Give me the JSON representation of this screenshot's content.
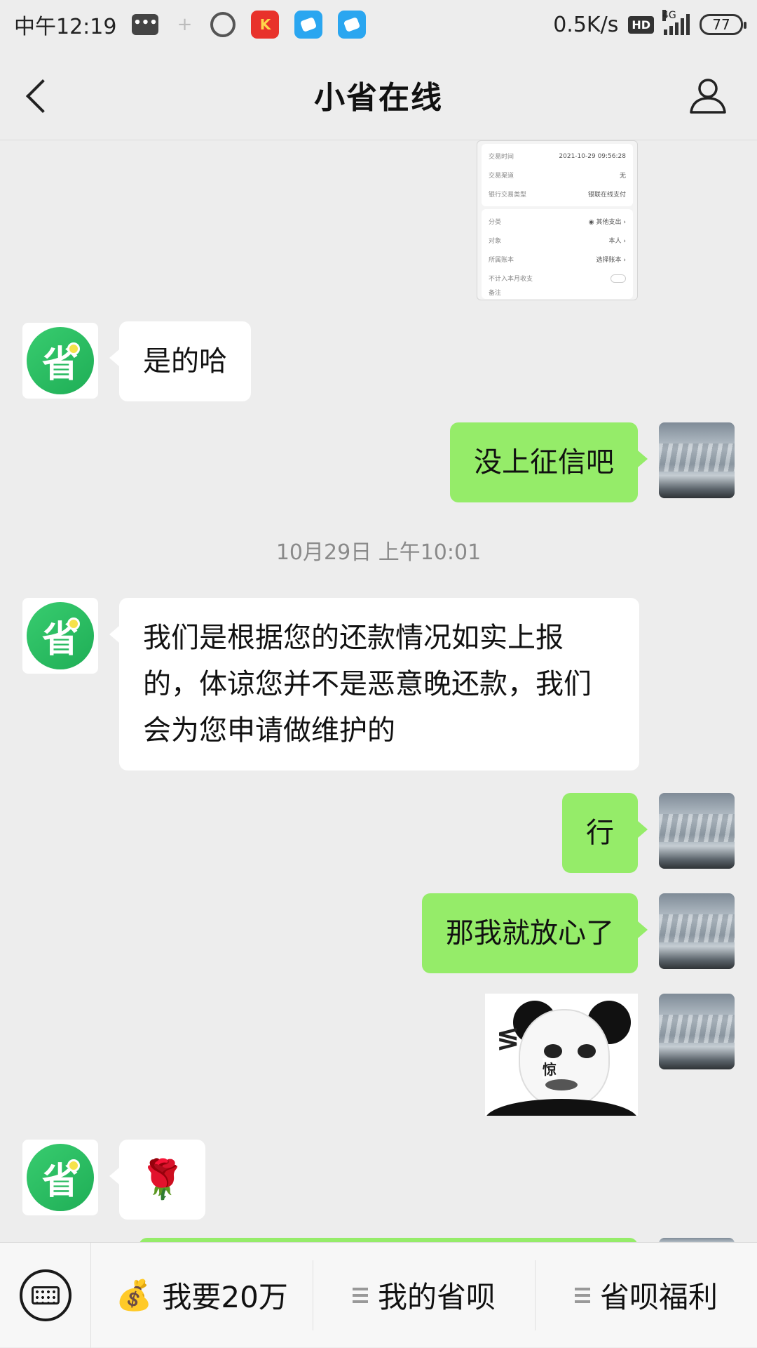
{
  "status_bar": {
    "time": "中午12:19",
    "net_speed": "0.5K/s",
    "hd": "HD",
    "network": "4G",
    "battery": "77",
    "app1_label": "K"
  },
  "header": {
    "title": "小省在线"
  },
  "receipt": {
    "rows_top": [
      {
        "label": "交易时间",
        "value": "2021-10-29 09:56:28"
      },
      {
        "label": "交易渠道",
        "value": "无"
      },
      {
        "label": "银行交易类型",
        "value": "银联在线支付"
      }
    ],
    "rows_bottom": [
      {
        "label": "分类",
        "value": "其他支出"
      },
      {
        "label": "对象",
        "value": "本人"
      },
      {
        "label": "所属账本",
        "value": "选择账本"
      },
      {
        "label": "不计入本月收支",
        "value": ""
      }
    ],
    "cut_label": "备注"
  },
  "bot_avatar_char": "省",
  "messages": {
    "m1": "是的哈",
    "m2": "没上征信吧",
    "timestamp": "10月29日 上午10:01",
    "m3": "我们是根据您的还款情况如实上报的，体谅您并不是恶意晚还款，我们会为您申请做维护的",
    "m4": "行",
    "m5": "那我就放心了",
    "meme_text": "惊",
    "meme_shock": "≶",
    "rose": "🌹"
  },
  "bottom_menu": {
    "item1": "我要20万",
    "item1_icon": "💰",
    "item2": "我的省呗",
    "item3": "省呗福利"
  }
}
